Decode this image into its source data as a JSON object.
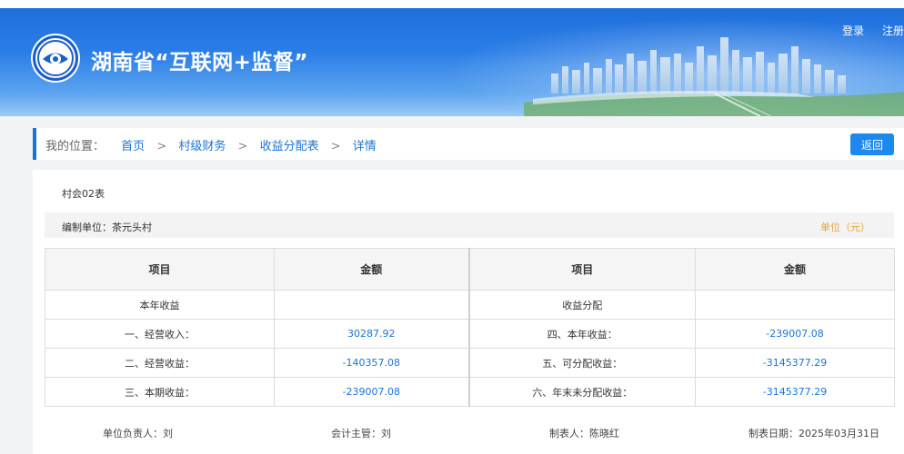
{
  "header": {
    "site_title": "湖南省“互联网+监督”",
    "login_label": "登录",
    "register_label": "注册"
  },
  "breadcrumb": {
    "label": "我的位置：",
    "items": [
      "首页",
      "村级财务",
      "收益分配表",
      "详情"
    ],
    "separator": ">"
  },
  "actions": {
    "back_label": "返回"
  },
  "report": {
    "code": "村会02表",
    "org_label": "编制单位：",
    "org_value": "茶元头村",
    "unit": "单位（元）",
    "headers": [
      "项目",
      "金额",
      "项目",
      "金额"
    ],
    "rows": [
      [
        "本年收益",
        "",
        "收益分配",
        ""
      ],
      [
        "一、经营收入：",
        "30287.92",
        "四、本年收益：",
        "-239007.08"
      ],
      [
        "二、经营收益：",
        "-140357.08",
        "五、可分配收益：",
        "-3145377.29"
      ],
      [
        "三、本期收益：",
        "-239007.08",
        "六、年末未分配收益：",
        "-3145377.29"
      ]
    ],
    "signatures": {
      "leader": "单位负责人：刘",
      "accountant": "会计主管：刘",
      "preparer": "制表人：陈晓红",
      "date": "制表日期：2025年03月31日"
    }
  },
  "colors": {
    "accent": "#1a74d6",
    "button": "#1e88f0",
    "unit_text": "#e6a23c",
    "banner_top": "#1f6fdc",
    "banner_bottom": "#9ccaf5"
  }
}
